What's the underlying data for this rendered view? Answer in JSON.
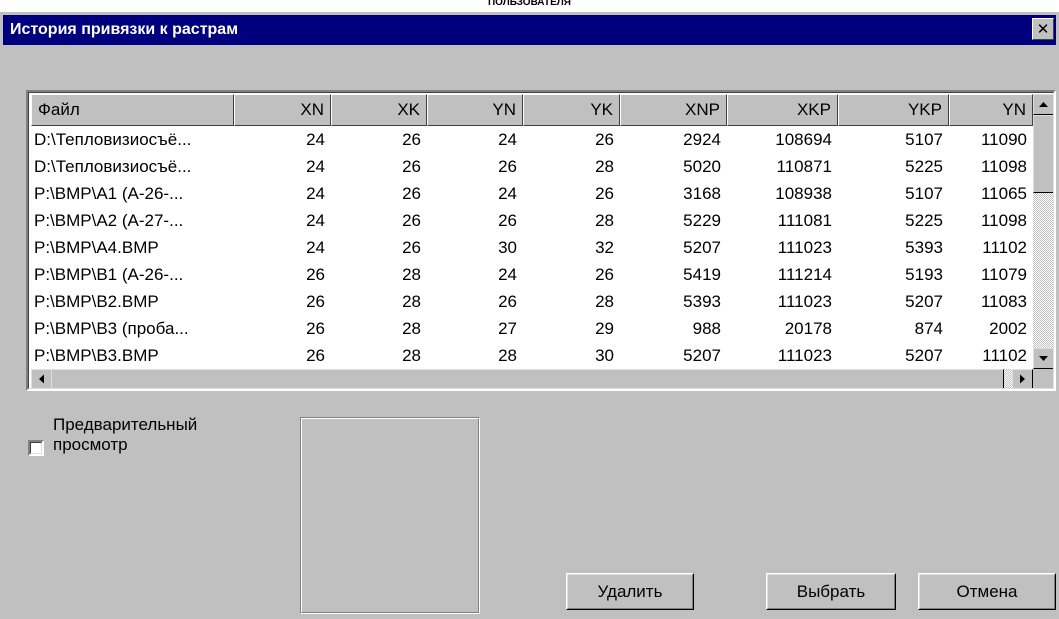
{
  "document_header": "ПОЛЬЗОВАТЕЛЯ",
  "window": {
    "title": "История привязки к растрам"
  },
  "table": {
    "columns": [
      "Файл",
      "XN",
      "XK",
      "YN",
      "YK",
      "XNP",
      "XKP",
      "YKP",
      "YN"
    ],
    "rows": [
      [
        "D:\\Тепловизиосъё...",
        "24",
        "26",
        "24",
        "26",
        "2924",
        "108694",
        "5107",
        "11090"
      ],
      [
        "D:\\Тепловизиосъё...",
        "24",
        "26",
        "26",
        "28",
        "5020",
        "110871",
        "5225",
        "11098"
      ],
      [
        "P:\\BMP\\A1 (A-26-...",
        "24",
        "26",
        "24",
        "26",
        "3168",
        "108938",
        "5107",
        "11065"
      ],
      [
        "P:\\BMP\\A2 (A-27-...",
        "24",
        "26",
        "26",
        "28",
        "5229",
        "111081",
        "5225",
        "11098"
      ],
      [
        "P:\\BMP\\A4.BMP",
        "24",
        "26",
        "30",
        "32",
        "5207",
        "111023",
        "5393",
        "11102"
      ],
      [
        "P:\\BMP\\B1 (A-26-...",
        "26",
        "28",
        "24",
        "26",
        "5419",
        "111214",
        "5193",
        "11079"
      ],
      [
        "P:\\BMP\\B2.BMP",
        "26",
        "28",
        "26",
        "28",
        "5393",
        "111023",
        "5207",
        "11083"
      ],
      [
        "P:\\BMP\\B3 (проба...",
        "26",
        "28",
        "27",
        "29",
        "988",
        "20178",
        "874",
        "2002"
      ],
      [
        "P:\\BMP\\B3.BMP",
        "26",
        "28",
        "28",
        "30",
        "5207",
        "111023",
        "5207",
        "11102"
      ]
    ]
  },
  "preview": {
    "label": "Предварительный просмотр",
    "checked": false
  },
  "buttons": {
    "delete": "Удалить",
    "select": "Выбрать",
    "cancel": "Отмена"
  },
  "icons": {
    "close": "close-icon",
    "scroll_up": "arrow-up-icon",
    "scroll_down": "arrow-down-icon",
    "scroll_left": "arrow-left-icon",
    "scroll_right": "arrow-right-icon"
  },
  "colors": {
    "titlebar": "#00007f",
    "face": "#c0c0c0",
    "window_bg": "#ffffff"
  }
}
